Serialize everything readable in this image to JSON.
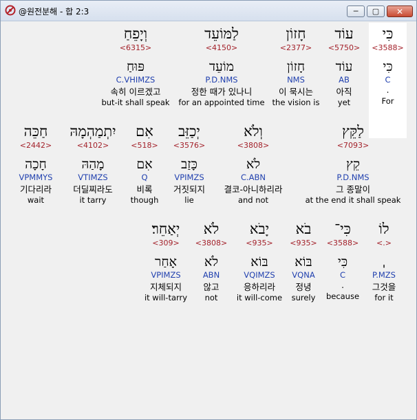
{
  "window": {
    "title": "@원전분해 - 합 2:3",
    "minimize": "─",
    "maximize": "▢",
    "close": "✕"
  },
  "words": [
    {
      "heb": "כִּי",
      "strong": "<3588>",
      "lemma": "כִּי",
      "morph": "C",
      "korean": ".",
      "english": "For"
    },
    {
      "heb": "עוֹד",
      "strong": "<5750>",
      "lemma": "עוֹד",
      "morph": "AB",
      "korean": "아직",
      "english": "yet"
    },
    {
      "heb": "חָזוֹן",
      "strong": "<2377>",
      "lemma": "חָזוֹן",
      "morph": "NMS",
      "korean": "이 묵시는",
      "english": "the vision is"
    },
    {
      "heb": "לַמּוֹעֵד",
      "strong": "<4150>",
      "lemma": "מוֹעֵד",
      "morph": "P.D.NMS",
      "korean": "정한 때가 있나니",
      "english": "for an appointed time"
    },
    {
      "heb": "וְיָפֵחַ",
      "strong": "<6315>",
      "lemma": "פּוּחַ",
      "morph": "C.VHIMZS",
      "korean": "속히 이르겠고",
      "english": "but-it shall speak"
    },
    {
      "heb": "לַקֵּץ",
      "strong": "<7093>",
      "lemma": "קֵץ",
      "morph": "P.D.NMS",
      "korean": "그 종말이",
      "english": "at the end it shall speak"
    },
    {
      "heb": "וְלֹא",
      "strong": "<3808>",
      "lemma": "לֹא",
      "morph": "C.ABN",
      "korean": "결코-아니하리라",
      "english": "and not"
    },
    {
      "heb": "יְכַזֵּב",
      "strong": "<3576>",
      "lemma": "כָּזַב",
      "morph": "VPIMZS",
      "korean": "거짓되지",
      "english": "lie"
    },
    {
      "heb": "אִם",
      "strong": "<518>",
      "lemma": "אִם",
      "morph": "Q",
      "korean": "비록",
      "english": "though"
    },
    {
      "heb": "יִתְמַהְמָהּ",
      "strong": "<4102>",
      "lemma": "מָהַהּ",
      "morph": "VTIMZS",
      "korean": "더딜찌라도",
      "english": "it tarry"
    },
    {
      "heb": "חַכֵּה",
      "strong": "<2442>",
      "lemma": "חָכָה",
      "morph": "VPMMYS",
      "korean": "기다리라",
      "english": "wait"
    },
    {
      "heb": "לוֹ",
      "strong": "<.>",
      "lemma": "ˌ",
      "morph": "P.MZS",
      "korean": "그것을",
      "english": "for it"
    },
    {
      "heb": "כִּי־",
      "strong": "<3588>",
      "lemma": "כִּי",
      "morph": "C",
      "korean": ".",
      "english": "because"
    },
    {
      "heb": "בֹא",
      "strong": "<935>",
      "lemma": "בּוֹא",
      "morph": "VQNA",
      "korean": "정녕",
      "english": "surely"
    },
    {
      "heb": "יָבֹא",
      "strong": "<935>",
      "lemma": "בּוֹא",
      "morph": "VQIMZS",
      "korean": "응하리라",
      "english": "it will-come"
    },
    {
      "heb": "לֹא",
      "strong": "<3808>",
      "lemma": "לֹא",
      "morph": "ABN",
      "korean": "않고",
      "english": "not"
    },
    {
      "heb": "יְאַחֵר׃",
      "strong": "<309>",
      "lemma": "אָחַר",
      "morph": "VPIMZS",
      "korean": "지체되지",
      "english": "it will-tarry"
    }
  ]
}
